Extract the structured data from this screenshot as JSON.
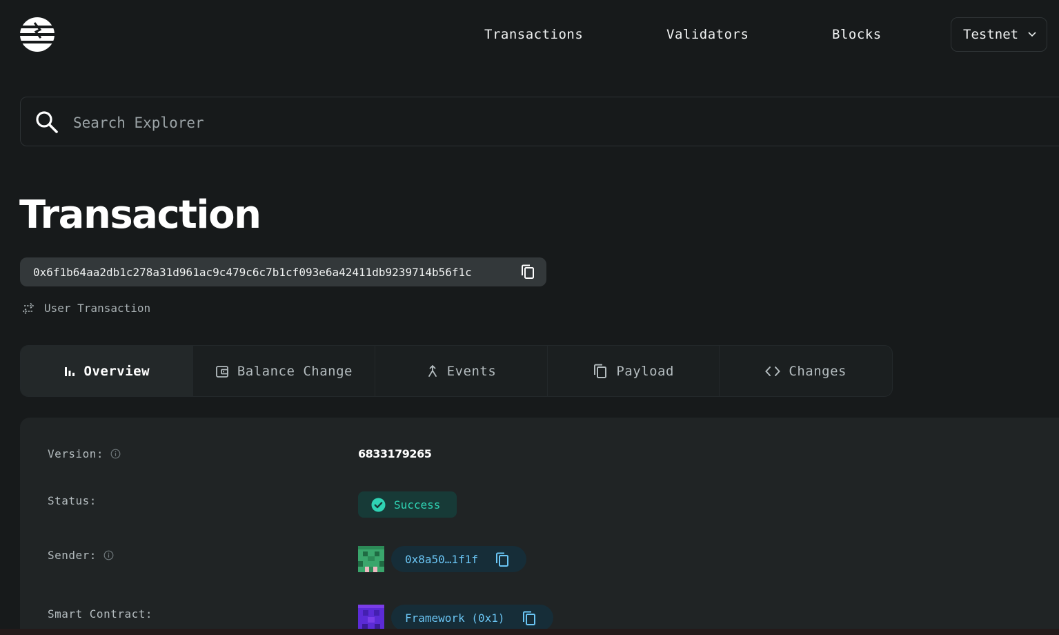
{
  "header": {
    "logo_icon": "aptos-logo-icon",
    "nav": [
      {
        "label": "Transactions"
      },
      {
        "label": "Validators"
      },
      {
        "label": "Blocks"
      }
    ],
    "network": "Testnet"
  },
  "search": {
    "placeholder": "Search Explorer"
  },
  "page": {
    "title": "Transaction",
    "hash": "0x6f1b64aa2db1c278a31d961ac9c479c6c7b1cf093e6a42411db9239714b56f1c",
    "tx_type": "User Transaction"
  },
  "tabs": [
    {
      "label": "Overview",
      "icon": "bar-chart-icon",
      "active": true
    },
    {
      "label": "Balance Change",
      "icon": "wallet-icon",
      "active": false
    },
    {
      "label": "Events",
      "icon": "merge-icon",
      "active": false
    },
    {
      "label": "Payload",
      "icon": "copy-icon",
      "active": false
    },
    {
      "label": "Changes",
      "icon": "code-icon",
      "active": false
    }
  ],
  "details": {
    "version_label": "Version:",
    "version_value": "6833179265",
    "status_label": "Status:",
    "status_value": "Success",
    "sender_label": "Sender:",
    "sender_value": "0x8a50…1f1f",
    "contract_label": "Smart Contract:",
    "contract_value": "Framework (0x1)"
  },
  "colors": {
    "background": "#171a1b",
    "card": "#202425",
    "success_text": "#2fd3b4",
    "success_bg": "#173a37",
    "address_text": "#6bc6f5",
    "address_bg": "#162d38"
  }
}
